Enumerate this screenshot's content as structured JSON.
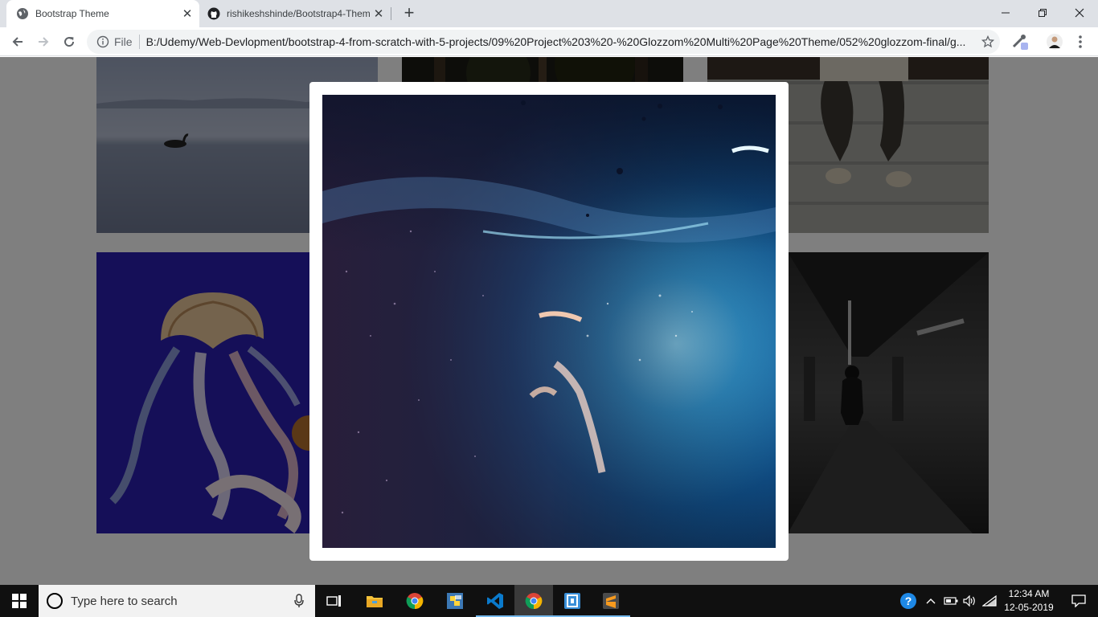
{
  "browser": {
    "tabs": [
      {
        "title": "Bootstrap Theme",
        "icon": "globe-icon",
        "active": true
      },
      {
        "title": "rishikeshshinde/Bootstrap4-Them",
        "icon": "github-icon",
        "active": false
      }
    ],
    "new_tab_label": "+",
    "close_glyph": "✕",
    "window_controls": {
      "minimize": "—",
      "maximize": "❐",
      "close": "✕"
    },
    "address": {
      "scheme_label": "File",
      "url": "B:/Udemy/Web-Devlopment/bootstrap-4-from-scratch-with-5-projects/09%20Project%203%20-%20Glozzom%20Multi%20Page%20Theme/052%20glozzom-final/g..."
    }
  },
  "page": {
    "gallery": [
      {
        "name": "gallery-image-lake-duck",
        "subject": "duck on misty lake",
        "colors": [
          "#96a0b4",
          "#727c92"
        ]
      },
      {
        "name": "gallery-image-forest",
        "subject": "dark forest",
        "colors": [
          "#2a2a22",
          "#151510"
        ]
      },
      {
        "name": "gallery-image-person-stairs",
        "subject": "person sitting on stairs",
        "colors": [
          "#a9aaa4",
          "#83847f"
        ]
      },
      {
        "name": "gallery-image-jellyfish",
        "subject": "jellyfish on blue",
        "colors": [
          "#2a1ea8",
          "#1c1396"
        ]
      },
      {
        "name": "gallery-image-underwater-swimmer",
        "subject": "underwater swimmer",
        "colors": [
          "#1a3a6a",
          "#0b1a35"
        ]
      },
      {
        "name": "gallery-image-corridor",
        "subject": "person in dark corridor",
        "colors": [
          "#555555",
          "#1a1a1a"
        ]
      }
    ],
    "modal": {
      "image": "underwater-swimmer",
      "colors": [
        "#2b6fa8",
        "#0b2a52",
        "#1a1c3a"
      ]
    }
  },
  "taskbar": {
    "search_placeholder": "Type here to search",
    "apps": [
      {
        "name": "task-view-button",
        "icon": "task-view-icon"
      },
      {
        "name": "file-explorer-button",
        "icon": "folder-icon"
      },
      {
        "name": "chrome-button",
        "icon": "chrome-icon"
      },
      {
        "name": "python-button",
        "icon": "python-icon"
      },
      {
        "name": "vscode-button",
        "icon": "vscode-icon"
      },
      {
        "name": "chrome-active-button",
        "icon": "chrome-icon"
      },
      {
        "name": "app-button",
        "icon": "app-icon"
      },
      {
        "name": "sublime-button",
        "icon": "sublime-icon"
      }
    ],
    "clock": {
      "time": "12:34 AM",
      "date": "12-05-2019"
    },
    "help_glyph": "?",
    "chevron_glyph": "^"
  }
}
